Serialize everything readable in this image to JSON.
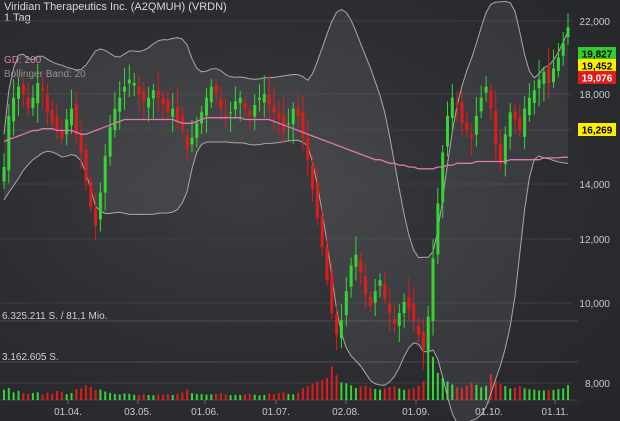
{
  "header": {
    "title": "Viridian Therapeutics Inc. (A2QMUH) (VRDN)",
    "interval": "1 Tag"
  },
  "indicators": {
    "ma_label": "GD: 200",
    "bollinger_label": "Bollinger Band: 20"
  },
  "colors": {
    "up": "#36d436",
    "down": "#e01b1b",
    "ma": "#e07ab0",
    "band": "#a8a8a8",
    "tag_green": "#32cd32",
    "tag_yellow": "#ffee00",
    "tag_red": "#e01b1b"
  },
  "chart_data": {
    "type": "candlestick",
    "y_ticks": [
      "22,000",
      "18,000",
      "16,000",
      "14,000",
      "12,000",
      "10,000",
      "8,000"
    ],
    "y_tick_values": [
      22,
      18,
      16,
      14,
      12,
      10,
      8
    ],
    "x_ticks": [
      "01.04.",
      "03.05.",
      "01.06.",
      "01.07.",
      "02.08.",
      "01.09.",
      "01.10.",
      "01.11."
    ],
    "price_tags": [
      {
        "label": "19,827",
        "value": 19.827,
        "style": "green"
      },
      {
        "label": "19,452",
        "value": 19.452,
        "style": "yellow"
      },
      {
        "label": "19,076",
        "value": 19.076,
        "style": "red"
      },
      {
        "label": "16,269",
        "value": 16.269,
        "style": "yellow"
      }
    ],
    "volume_labels": [
      "6.325.211 S. / 81,1 Mio.",
      "3.162.605 S."
    ],
    "volume_max": 6325211,
    "close": [
      16.0,
      17.4,
      17.9,
      18.2,
      18.0,
      17.6,
      17.9,
      18.3,
      18.1,
      17.5,
      17.2,
      17.0,
      16.8,
      17.3,
      17.6,
      16.9,
      16.4,
      15.6,
      14.9,
      14.4,
      15.3,
      16.3,
      17.1,
      17.6,
      17.9,
      18.2,
      18.4,
      18.3,
      18.0,
      17.8,
      17.9,
      18.1,
      17.9,
      17.7,
      17.5,
      17.6,
      17.3,
      17.0,
      16.5,
      16.8,
      17.2,
      17.5,
      17.9,
      18.2,
      18.0,
      17.6,
      17.4,
      17.5,
      17.8,
      17.9,
      17.6,
      17.4,
      17.7,
      17.9,
      18.0,
      17.7,
      17.5,
      17.3,
      17.0,
      17.2,
      17.6,
      17.4,
      16.8,
      16.2,
      15.4,
      14.6,
      13.8,
      12.9,
      12.0,
      11.4,
      11.8,
      12.6,
      13.3,
      13.6,
      13.1,
      12.5,
      12.2,
      12.6,
      12.9,
      12.4,
      12.0,
      11.7,
      12.0,
      12.3,
      12.1,
      11.8,
      11.4,
      11.0,
      11.9,
      13.5,
      15.0,
      16.4,
      17.4,
      17.9,
      17.7,
      17.2,
      17.0,
      16.8,
      17.4,
      17.9,
      18.2,
      17.6,
      16.6,
      16.1,
      16.9,
      17.5,
      17.3,
      17.0,
      17.6,
      17.9,
      18.1,
      18.4,
      18.6,
      18.3,
      18.7,
      19.0,
      19.4,
      19.827
    ],
    "ma200": [
      16.7,
      16.75,
      16.8,
      16.85,
      16.9,
      16.95,
      17.0,
      17.0,
      17.05,
      17.05,
      17.05,
      17.0,
      17.0,
      17.0,
      17.0,
      16.95,
      16.9,
      16.9,
      16.95,
      17.0,
      17.05,
      17.1,
      17.15,
      17.2,
      17.25,
      17.3,
      17.3,
      17.3,
      17.3,
      17.3,
      17.3,
      17.3,
      17.3,
      17.3,
      17.3,
      17.3,
      17.25,
      17.2,
      17.2,
      17.2,
      17.25,
      17.3,
      17.35,
      17.35,
      17.35,
      17.35,
      17.35,
      17.35,
      17.35,
      17.35,
      17.3,
      17.3,
      17.3,
      17.3,
      17.3,
      17.3,
      17.25,
      17.2,
      17.15,
      17.1,
      17.05,
      17.0,
      16.95,
      16.9,
      16.85,
      16.8,
      16.75,
      16.7,
      16.65,
      16.6,
      16.55,
      16.5,
      16.45,
      16.4,
      16.35,
      16.3,
      16.25,
      16.2,
      16.2,
      16.15,
      16.1,
      16.1,
      16.05,
      16.05,
      16.0,
      16.0,
      15.95,
      15.95,
      15.95,
      15.95,
      16.0,
      16.0,
      16.05,
      16.05,
      16.1,
      16.1,
      16.1,
      16.1,
      16.15,
      16.15,
      16.15,
      16.15,
      16.15,
      16.15,
      16.15,
      16.2,
      16.2,
      16.2,
      16.2,
      16.2,
      16.2,
      16.2,
      16.25,
      16.25,
      16.25,
      16.25,
      16.27,
      16.269
    ],
    "volume": [
      820000,
      960000,
      610000,
      740000,
      570000,
      490000,
      560000,
      620000,
      430000,
      590000,
      500000,
      720000,
      650000,
      470000,
      560000,
      880000,
      940000,
      1180000,
      1060000,
      780000,
      840000,
      670000,
      570000,
      490000,
      450000,
      530000,
      500000,
      420000,
      390000,
      460000,
      410000,
      380000,
      440000,
      450000,
      480000,
      400000,
      520000,
      610000,
      870000,
      550000,
      480000,
      470000,
      440000,
      460000,
      490000,
      520000,
      430000,
      390000,
      420000,
      400000,
      450000,
      470000,
      420000,
      380000,
      400000,
      520000,
      470000,
      560000,
      610000,
      490000,
      460000,
      580000,
      930000,
      1120000,
      1330000,
      1480000,
      1600000,
      1760000,
      2680000,
      1980000,
      1420000,
      1340000,
      1180000,
      960000,
      1090000,
      1160000,
      1000000,
      880000,
      830000,
      940000,
      1040000,
      1090000,
      930000,
      820000,
      870000,
      960000,
      1150000,
      1530000,
      6325211,
      3450000,
      2180000,
      1760000,
      1480000,
      1230000,
      1020000,
      960000,
      1160000,
      1380000,
      1220000,
      1010000,
      1140000,
      2080000,
      1530000,
      1270000,
      1110000,
      920000,
      990000,
      1100000,
      930000,
      860000,
      830000,
      770000,
      760000,
      820000,
      790000,
      860000,
      930000,
      1180000
    ]
  }
}
